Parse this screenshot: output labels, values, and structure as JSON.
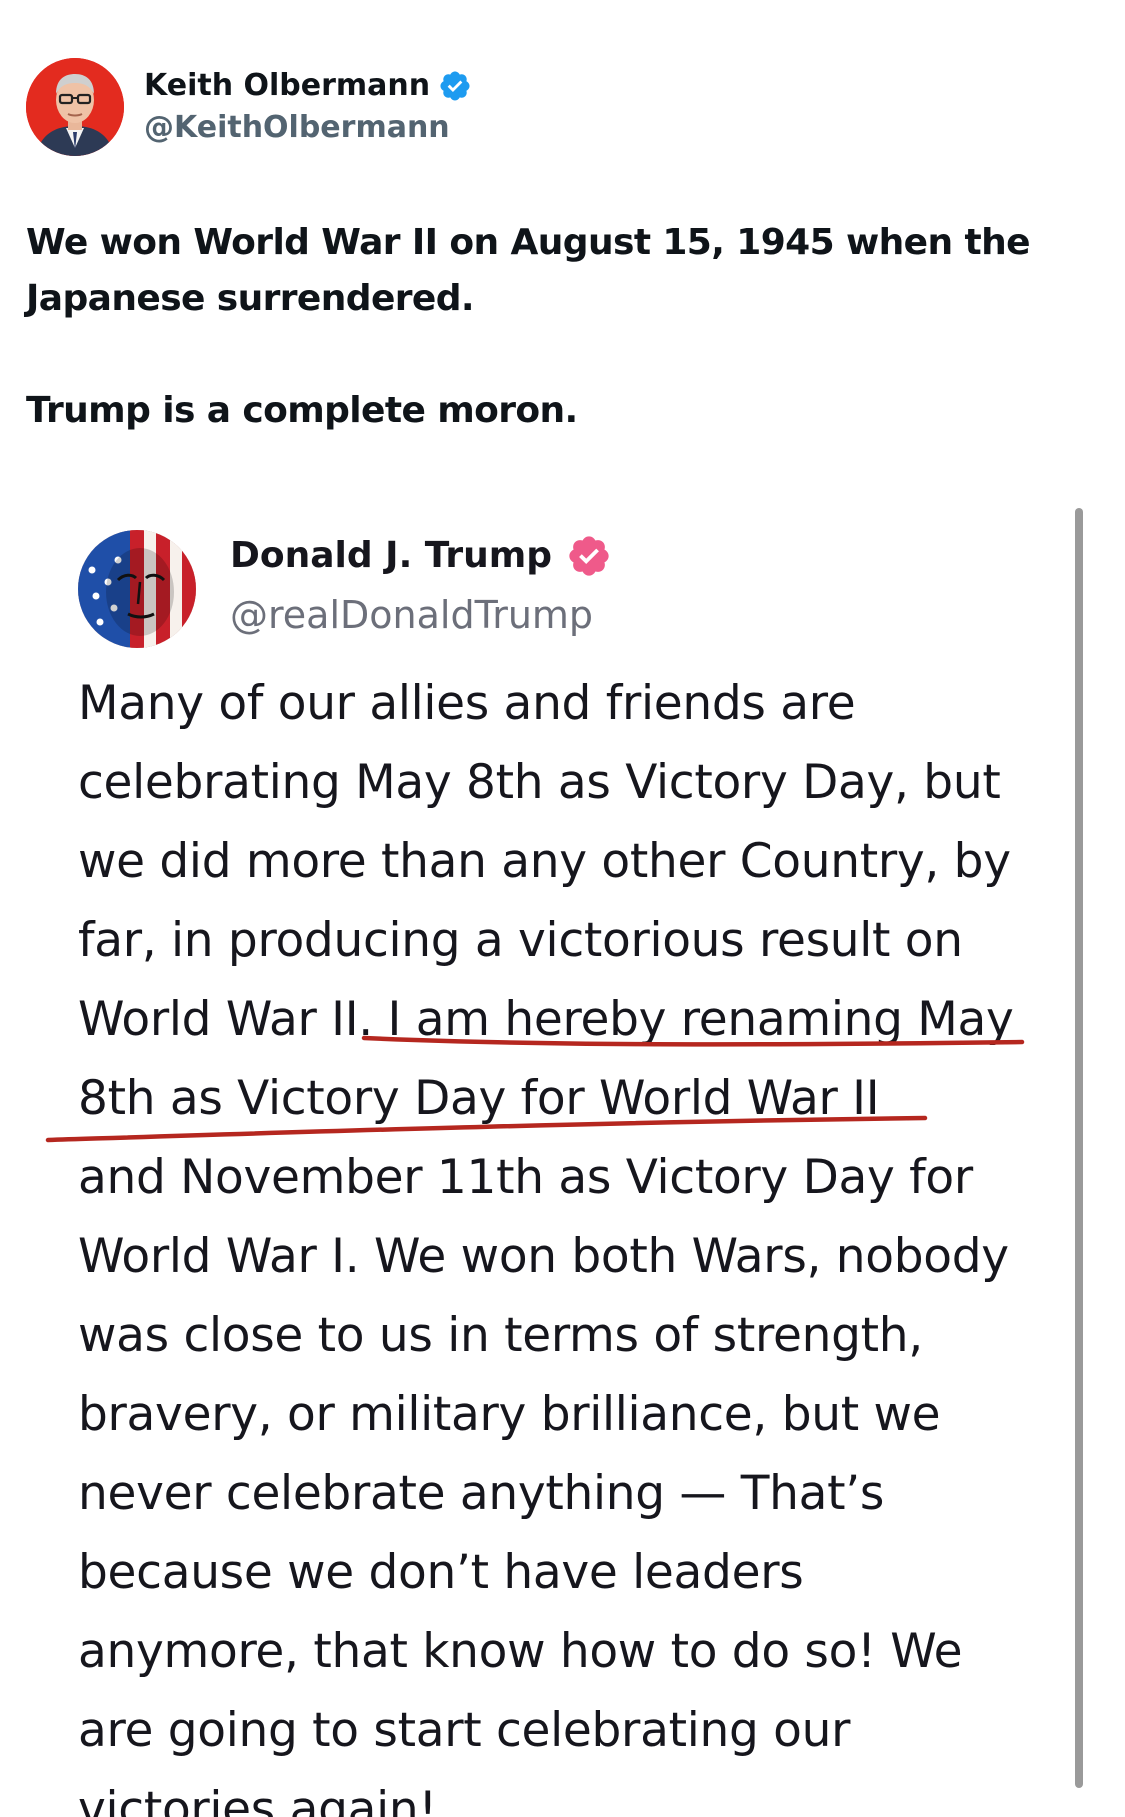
{
  "outer_post": {
    "author": {
      "display_name": "Keith Olbermann",
      "handle": "@KeithOlbermann",
      "verified": true,
      "avatar_icon": "profile-photo"
    },
    "paragraphs": [
      "We won World War II on August 15, 1945 when the Japanese surrendered.",
      "Trump is a complete moron."
    ],
    "paragraph_lines": [
      [
        "We won World War II on August 15, 1945 when the",
        "Japanese surrendered."
      ],
      [
        "Trump is a complete moron."
      ]
    ]
  },
  "quoted_post": {
    "author": {
      "display_name": "Donald J. Trump",
      "handle": "@realDonaldTrump",
      "verified": true,
      "avatar_icon": "flag-face-avatar"
    },
    "text_lines": [
      "Many of our allies and friends are",
      "celebrating May 8th as Victory Day, but",
      "we did more than any other Country, by",
      "far, in producing a victorious result on",
      "World War II. I am hereby renaming May",
      "8th as Victory Day for World War II",
      "and November 11th as Victory Day for",
      "World War I. We won both Wars, nobody",
      "was close to us in terms of strength,",
      "bravery, or military brilliance, but we",
      "never celebrate anything — That’s",
      "because we don’t have leaders",
      " anymore, that know how to do so! We",
      "are going to start celebrating our",
      "victories again!"
    ],
    "underlined_phrase": ". I am hereby renaming May 8th as Victory Day for World War II"
  },
  "colors": {
    "text_primary": "#0f1419",
    "text_secondary": "#536471",
    "verified_blue": "#1d9bf0",
    "verified_pink": "#ef5a8a",
    "annotation_red": "#b5271f",
    "scrollbar": "#9a9a9a"
  }
}
